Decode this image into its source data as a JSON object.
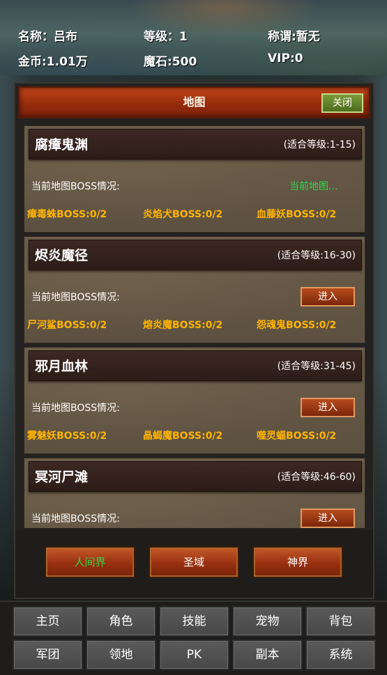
{
  "player": {
    "name": "名称：吕布",
    "level": "等级：1",
    "title": "称谓:暂无",
    "gold": "金币:1.01万",
    "magic_stone": "魔石:500",
    "vip": "VIP:0"
  },
  "panel": {
    "title": "地图",
    "close_label": "关闭",
    "boss_status_label": "当前地图BOSS情况:",
    "current_map_label": "当前地图...",
    "enter_label": "进入"
  },
  "maps": [
    {
      "name": "腐瘴鬼渊",
      "level": "(适合等级:1-15)",
      "bosses": [
        "瘴毒蛛BOSS:0/2",
        "炎焰犬BOSS:0/2",
        "血藤妖BOSS:0/2"
      ]
    },
    {
      "name": "烬炎魔径",
      "level": "(适合等级:16-30)",
      "bosses": [
        "尸河鲨BOSS:0/2",
        "熔炎魔BOSS:0/2",
        "怨魂鬼BOSS:0/2"
      ]
    },
    {
      "name": "邪月血林",
      "level": "(适合等级:31-45)",
      "bosses": [
        "雾魅妖BOSS:0/2",
        "晶蝎魔BOSS:0/2",
        "噬灵蝠BOSS:0/2"
      ]
    },
    {
      "name": "冥河尸滩",
      "level": "(适合等级:46-60)",
      "bosses": []
    }
  ],
  "realms": [
    "人间界",
    "圣域",
    "神界"
  ],
  "nav": {
    "row1": [
      "主页",
      "角色",
      "技能",
      "宠物",
      "背包"
    ],
    "row2": [
      "军团",
      "领地",
      "PK",
      "副本",
      "系统"
    ]
  },
  "colors": {
    "accent_header": "#9b2e0e",
    "boss_text": "#ffb400",
    "current_map_text": "#2fd84a",
    "close_button": "#4e6d1f"
  }
}
